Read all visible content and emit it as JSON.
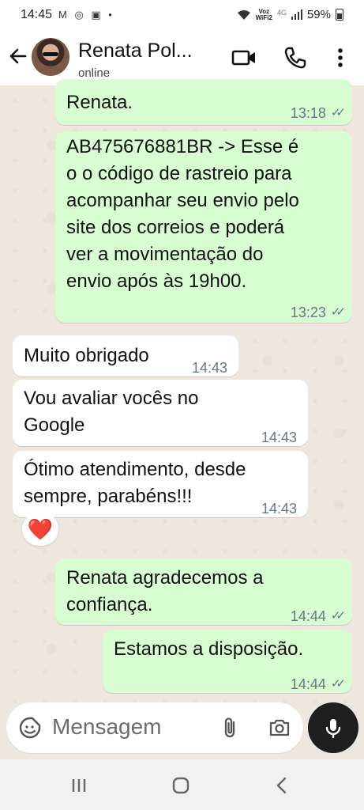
{
  "status_bar": {
    "time": "14:45",
    "left_icons": "M ◎ ▣ •",
    "network_top": "Voz",
    "network_bottom": "WiFi2",
    "signal_label": "4G",
    "battery": "59%"
  },
  "header": {
    "contact_name": "Renata Pol...",
    "status": "online"
  },
  "messages": [
    {
      "text": "Renata.",
      "time": "13:18",
      "direction": "out"
    },
    {
      "text": "AB475676881BR -> Esse é\no o código de rastreio para\nacompanhar seu envio pelo\nsite dos correios e poderá\nver a movimentação do\nenvio após às 19h00.",
      "time": "13:23",
      "direction": "out"
    },
    {
      "text": "Muito obrigado",
      "time": "14:43",
      "direction": "in"
    },
    {
      "text": "Vou avaliar vocês no\nGoogle",
      "time": "14:43",
      "direction": "in"
    },
    {
      "text": "Ótimo atendimento, desde\nsempre, parabéns!!!",
      "time": "14:43",
      "direction": "in"
    },
    {
      "text": "Renata agradecemos a\nconfiança.",
      "time": "14:44",
      "direction": "out"
    },
    {
      "text": "Estamos a disposição.",
      "time": "14:44",
      "direction": "out"
    }
  ],
  "reaction": "❤️",
  "composer": {
    "placeholder": "Mensagem"
  },
  "icons": {
    "back": "arrow-left",
    "video": "video-camera",
    "call": "phone",
    "menu": "more-vertical",
    "emoji": "sticker-emoji",
    "attach": "paperclip",
    "camera": "camera",
    "mic": "microphone"
  },
  "colors": {
    "outgoing": "#d9fdd3",
    "incoming": "#ffffff",
    "background": "#efe7dd",
    "mic_button": "#1f1f1f"
  }
}
